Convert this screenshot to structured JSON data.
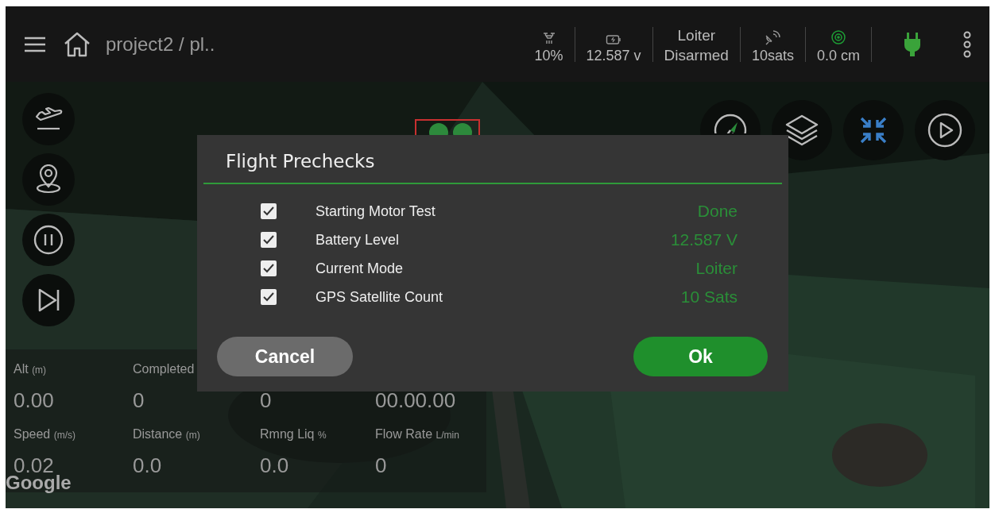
{
  "top_bar": {
    "title": "project2 / pl..",
    "status": [
      {
        "kind": "drone",
        "lines": [
          "10%"
        ]
      },
      {
        "kind": "battery",
        "lines": [
          "12.587 v"
        ]
      },
      {
        "kind": "text",
        "lines": [
          "Loiter",
          "Disarmed"
        ]
      },
      {
        "kind": "satellite",
        "lines": [
          "10sats"
        ]
      },
      {
        "kind": "target",
        "lines": [
          "0.0 cm"
        ]
      }
    ]
  },
  "left_buttons": [
    {
      "kind": "takeoff"
    },
    {
      "kind": "location"
    },
    {
      "kind": "pause"
    },
    {
      "kind": "skip"
    }
  ],
  "right_buttons": [
    {
      "kind": "compass"
    },
    {
      "kind": "layers"
    },
    {
      "kind": "collapse"
    },
    {
      "kind": "play"
    }
  ],
  "stats": [
    [
      {
        "label": "Alt",
        "unit": "(m)",
        "value": "0.00"
      },
      {
        "label": "Completed",
        "value": "0"
      },
      {
        "value": "0"
      },
      {
        "value": "00.00.00"
      }
    ],
    [
      {
        "label": "Speed",
        "unit": "(m/s)",
        "value": "0.02"
      },
      {
        "label": "Distance",
        "unit": "(m)",
        "value": "0.0"
      },
      {
        "label": "Rmng Liq",
        "unit": "%",
        "value": "0.0"
      },
      {
        "label": "Flow Rate",
        "unit": "L/min",
        "value": "0"
      }
    ]
  ],
  "map_attribution": "Google",
  "dialog": {
    "title": "Flight Prechecks",
    "checks": [
      {
        "label": "Starting Motor Test",
        "value": "Done",
        "checked": true
      },
      {
        "label": "Battery Level",
        "value": "12.587 V",
        "checked": true
      },
      {
        "label": "Current Mode",
        "value": "Loiter",
        "checked": true
      },
      {
        "label": "GPS Satellite Count",
        "value": "10 Sats",
        "checked": true
      }
    ],
    "buttons": [
      {
        "kind": "secondary",
        "label": "Cancel"
      },
      {
        "kind": "primary",
        "label": "Ok"
      }
    ]
  }
}
